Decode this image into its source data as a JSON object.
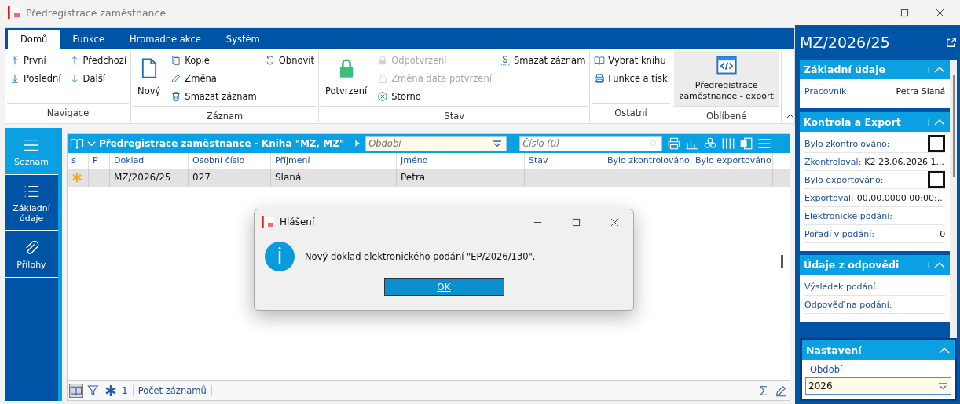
{
  "window": {
    "title": "Předregistrace zaměstnance"
  },
  "ribbon": {
    "tabs": [
      {
        "label": "Domů",
        "selected": true
      },
      {
        "label": "Funkce",
        "selected": false
      },
      {
        "label": "Hromadné akce",
        "selected": false
      },
      {
        "label": "Systém",
        "selected": false
      }
    ],
    "groups": [
      {
        "label": "Navigace",
        "columns": [
          [
            {
              "kind": "small",
              "label": "První",
              "disabled": false
            },
            {
              "kind": "small",
              "label": "Poslední",
              "disabled": false
            }
          ],
          [
            {
              "kind": "small",
              "label": "Předchozí",
              "disabled": false
            },
            {
              "kind": "small",
              "label": "Další",
              "disabled": false
            }
          ]
        ]
      },
      {
        "label": "Záznam",
        "columns": [
          [
            {
              "kind": "large",
              "label": "Nový",
              "disabled": false,
              "highlighted": false
            }
          ],
          [
            {
              "kind": "small",
              "label": "Kopie",
              "disabled": false
            },
            {
              "kind": "small",
              "label": "Změna",
              "disabled": false
            },
            {
              "kind": "small",
              "label": "Smazat záznam",
              "disabled": false
            }
          ],
          [
            {
              "kind": "small",
              "label": "Obnovit",
              "disabled": false
            }
          ]
        ]
      },
      {
        "label": "Stav",
        "columns": [
          [
            {
              "kind": "large",
              "label": "Potvrzení",
              "disabled": false,
              "highlighted": false
            }
          ],
          [
            {
              "kind": "small",
              "label": "Odpotvrzení",
              "disabled": true
            },
            {
              "kind": "small",
              "label": "Změna data potvrzení",
              "disabled": true
            },
            {
              "kind": "small",
              "label": "Storno",
              "disabled": false
            }
          ],
          [
            {
              "kind": "small",
              "label": "Smazat záznam",
              "disabled": false
            }
          ]
        ]
      },
      {
        "label": "Ostatní",
        "columns": [
          [
            {
              "kind": "small",
              "label": "Vybrat knihu",
              "disabled": false
            },
            {
              "kind": "small",
              "label": "Funkce a tisk",
              "disabled": false
            }
          ]
        ]
      },
      {
        "label": "Oblíbené",
        "columns": [
          [
            {
              "kind": "large",
              "label": "Předregistrace zaměstnance - export",
              "disabled": false,
              "highlighted": true
            }
          ]
        ]
      }
    ]
  },
  "nav": [
    {
      "label": "Seznam",
      "selected": true
    },
    {
      "label": "Základní údaje",
      "selected": false
    },
    {
      "label": "Přílohy",
      "selected": false
    }
  ],
  "grid": {
    "title": "Předregistrace zaměstnance - Kniha \"MZ, MZ\"",
    "period_field": {
      "placeholder": "Období"
    },
    "number_field": {
      "placeholder": "Číslo (0)"
    },
    "columns": [
      "s",
      "P",
      "Doklad",
      "Osobní číslo",
      "Příjmení",
      "Jméno",
      "Stav",
      "Bylo zkontrolováno",
      "Bylo exportováno"
    ],
    "rows": [
      {
        "selected": true,
        "new": true,
        "doklad": "MZ/2026/25",
        "osobni_cislo": "027",
        "prijmeni": "Slaná",
        "jmeno": "Petra"
      }
    ],
    "footer": {
      "count": "1",
      "label": "Počet záznamů"
    }
  },
  "dialog": {
    "title": "Hlášení",
    "message": "Nový doklad elektronického podání \"EP/2026/130\".",
    "button": "OK"
  },
  "detail": {
    "title": "MZ/2026/25",
    "sections": [
      {
        "title": "Základní údaje",
        "fields": [
          {
            "kind": "pair",
            "label": "Pracovník:",
            "value": "Petra Slaná"
          }
        ]
      },
      {
        "title": "Kontrola a Export",
        "fields": [
          {
            "kind": "checkbox",
            "label": "Bylo zkontrolováno:",
            "checked": false
          },
          {
            "kind": "inline",
            "label": "Zkontroloval:",
            "value": "K2 23.06.2026 1..."
          },
          {
            "kind": "checkbox",
            "label": "Bylo exportováno:",
            "checked": false
          },
          {
            "kind": "inline",
            "label": "Exportoval:",
            "value": "00.00.0000 00:00:..."
          },
          {
            "kind": "label",
            "label": "Elektronické podání:"
          },
          {
            "kind": "pair",
            "label": "Pořadí v podání:",
            "value": "0"
          }
        ]
      },
      {
        "title": "Údaje z odpovědi",
        "fields": [
          {
            "kind": "label",
            "label": "Výsledek podání:"
          },
          {
            "kind": "label",
            "label": "Odpověď na podání:"
          }
        ]
      }
    ],
    "settings": {
      "title": "Nastavení",
      "label": "Období",
      "value": "2026"
    }
  }
}
